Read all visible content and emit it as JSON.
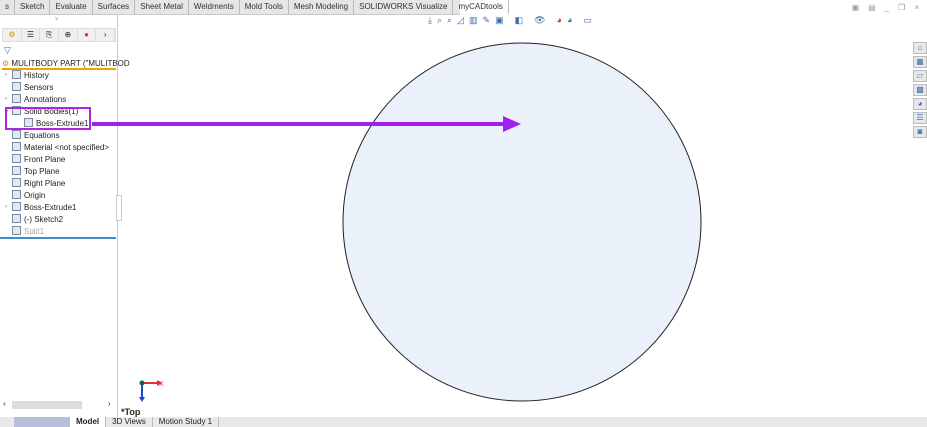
{
  "ribbon_tabs": [
    "s",
    "Sketch",
    "Evaluate",
    "Surfaces",
    "Sheet Metal",
    "Weldments",
    "Mold Tools",
    "Mesh Modeling",
    "SOLIDWORKS Visualize",
    "myCADtools"
  ],
  "window_controls": [
    "restore-icon",
    "tile-icon",
    "minimize",
    "maximize",
    "close"
  ],
  "panel": {
    "tabs": [
      "feature-manager-icon",
      "property-manager-icon",
      "configuration-manager-icon",
      "dimxpert-icon",
      "display-manager-icon",
      "more-icon"
    ],
    "root": "MULITBODY PART (\"MULITBOD",
    "items": [
      {
        "label": "History",
        "expand": true,
        "icon": "history-icon"
      },
      {
        "label": "Sensors",
        "expand": false,
        "icon": "sensors-icon"
      },
      {
        "label": "Annotations",
        "expand": true,
        "icon": "annotations-icon"
      },
      {
        "label": "Solid Bodies(1)",
        "expand": true,
        "expanded": true,
        "icon": "solid-bodies-icon"
      },
      {
        "label": "Boss-Extrude1",
        "indent": true,
        "icon": "solid-body-icon"
      },
      {
        "label": "Equations",
        "icon": "equations-icon"
      },
      {
        "label": "Material <not specified>",
        "icon": "material-icon"
      },
      {
        "label": "Front Plane",
        "icon": "plane-icon"
      },
      {
        "label": "Top Plane",
        "icon": "plane-icon"
      },
      {
        "label": "Right Plane",
        "icon": "plane-icon"
      },
      {
        "label": "Origin",
        "icon": "origin-icon"
      },
      {
        "label": "Boss-Extrude1",
        "expand": true,
        "icon": "extrude-icon"
      },
      {
        "label": "(-) Sketch2",
        "icon": "sketch-icon"
      },
      {
        "label": "Split1",
        "disabled": true,
        "icon": "split-icon"
      }
    ]
  },
  "viewport": {
    "view_label": "*Top",
    "axis_x": "X",
    "circle_fill": "#eaf1fb",
    "arrow_color": "#a020f0"
  },
  "bottom_tabs": [
    "Model",
    "3D Views",
    "Motion Study 1"
  ],
  "right_toolbar": [
    "home-icon",
    "parts-icon",
    "folder-icon",
    "appearances-icon",
    "color-wheel-icon",
    "list-icon",
    "custom-icon"
  ]
}
